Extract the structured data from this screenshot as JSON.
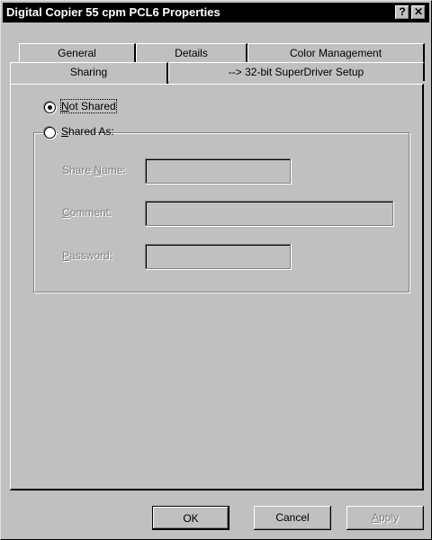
{
  "window": {
    "title": "Digital Copier 55 cpm PCL6 Properties",
    "help_label": "?",
    "close_label": "✕"
  },
  "tabs": {
    "general": "General",
    "details": "Details",
    "color_management": "Color Management",
    "sharing": "Sharing",
    "superdriver": "--> 32-bit SuperDriver Setup"
  },
  "sharing": {
    "not_shared": {
      "prefix": "",
      "accel": "N",
      "rest": "ot Shared",
      "selected": true
    },
    "shared_as": {
      "prefix": "",
      "accel": "S",
      "rest": "hared As:",
      "selected": false
    },
    "share_name": {
      "prefix": "Share ",
      "accel": "N",
      "rest": "ame:",
      "value": ""
    },
    "comment": {
      "prefix": "",
      "accel": "C",
      "rest": "omment:",
      "value": ""
    },
    "password": {
      "prefix": "",
      "accel": "P",
      "rest": "assword:",
      "value": ""
    }
  },
  "buttons": {
    "ok": "OK",
    "cancel": "Cancel",
    "apply": {
      "prefix": "",
      "accel": "A",
      "rest": "pply"
    }
  }
}
